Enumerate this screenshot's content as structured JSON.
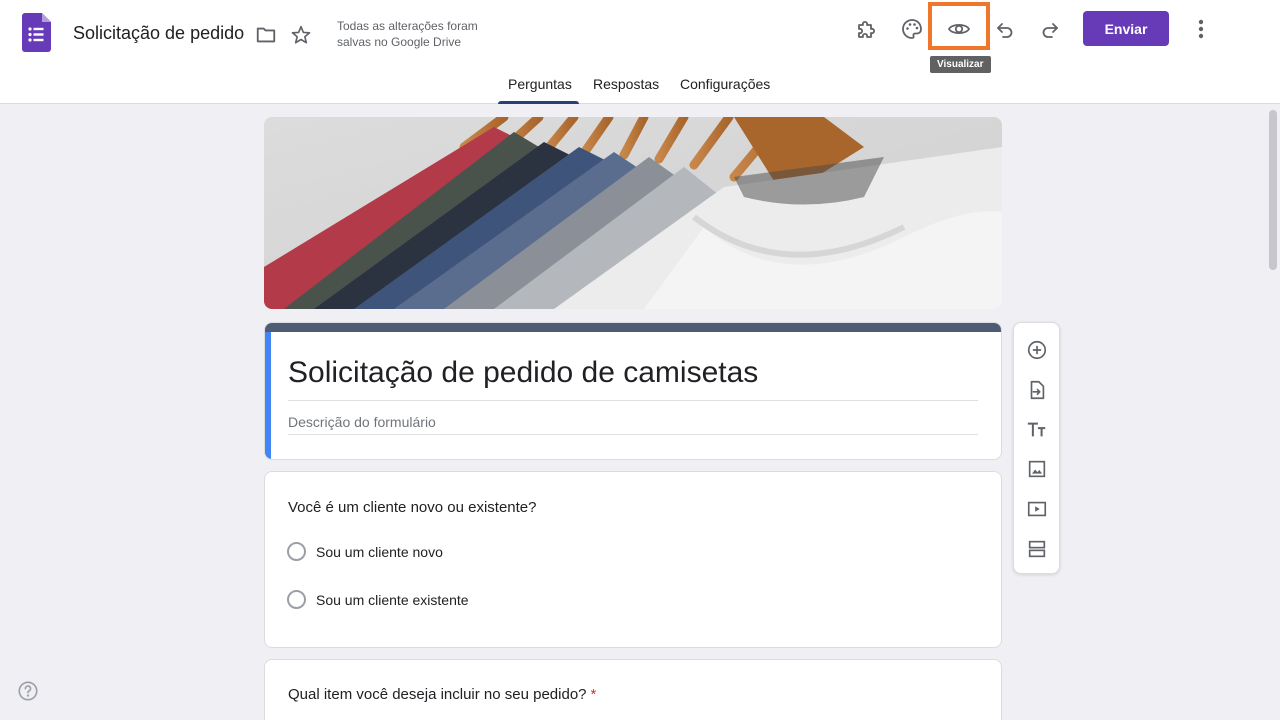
{
  "header": {
    "title": "Solicitação de pedido",
    "save_status": "Todas as alterações foram salvas no Google Drive",
    "icons": [
      "addons-icon",
      "palette-icon",
      "preview-icon",
      "undo-icon",
      "redo-icon",
      "more-vert-icon"
    ],
    "tooltip": "Visualizar",
    "send_label": "Enviar",
    "accent_color": "#673ab7",
    "highlight_color": "#f0762b"
  },
  "tabs": [
    {
      "label": "Perguntas",
      "active": true
    },
    {
      "label": "Respostas",
      "active": false
    },
    {
      "label": "Configurações",
      "active": false
    }
  ],
  "form": {
    "title": "Solicitação de pedido de camisetas",
    "description_placeholder": "Descrição do formulário"
  },
  "questions": [
    {
      "title": "Você é um cliente novo ou existente?",
      "required": false,
      "options": [
        "Sou um cliente novo",
        "Sou um cliente existente"
      ]
    },
    {
      "title": "Qual item você deseja incluir no seu pedido?",
      "required": true,
      "required_mark": "*"
    }
  ],
  "side_toolbar": [
    "add-question-icon",
    "import-questions-icon",
    "add-title-icon",
    "add-image-icon",
    "add-video-icon",
    "add-section-icon"
  ]
}
